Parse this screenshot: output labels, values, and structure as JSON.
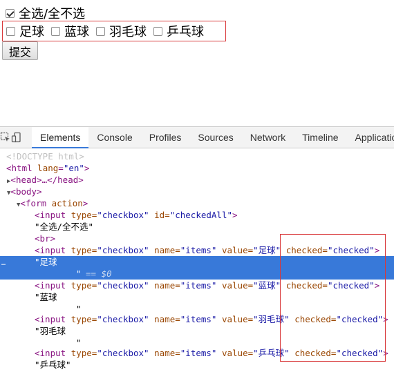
{
  "page": {
    "select_all": {
      "label": "全选/全不选",
      "checked": true
    },
    "items": [
      {
        "label": "足球",
        "checked": false
      },
      {
        "label": "蓝球",
        "checked": false
      },
      {
        "label": "羽毛球",
        "checked": false
      },
      {
        "label": "乒乓球",
        "checked": false
      }
    ],
    "submit_label": "提交"
  },
  "devtools": {
    "tabs": [
      "Elements",
      "Console",
      "Profiles",
      "Sources",
      "Network",
      "Timeline",
      "Application"
    ],
    "active_tab": "Elements",
    "dom": {
      "doctype": "<!DOCTYPE html>",
      "html_open": "<html",
      "html_lang_attr": "lang",
      "html_lang_val": "\"en\"",
      "html_close_bracket": ">",
      "head_collapsed": "<head>…</head>",
      "body_open": "<body>",
      "form_open": "<form",
      "form_attr": "action",
      "form_close_bracket": ">",
      "input_tag": "<input",
      "type_attr": "type=",
      "type_val": "\"checkbox\"",
      "id_attr": "id=",
      "id_val": "\"checkedAll\"",
      "name_attr": "name=",
      "name_val": "\"items\"",
      "value_attr": "value=",
      "checked_attr": "checked=",
      "checked_val": "\"checked\"",
      "close_bracket": ">",
      "text_select_all": "\"全选/全不选\"",
      "br": "<br>",
      "value_1": "\"足球\"",
      "value_2": "\"蓝球\"",
      "value_3": "\"羽毛球\"",
      "value_4": "\"乒乓球\"",
      "text_1": "\"足球",
      "text_1_tail": "\"",
      "text_1_ref": "== $0",
      "text_2": "\"蓝球",
      "text_2_tail": "\"",
      "text_3": "\"羽毛球",
      "text_3_tail": "\"",
      "text_4": "\"乒乓球\"",
      "selection_gutter": "…"
    }
  }
}
